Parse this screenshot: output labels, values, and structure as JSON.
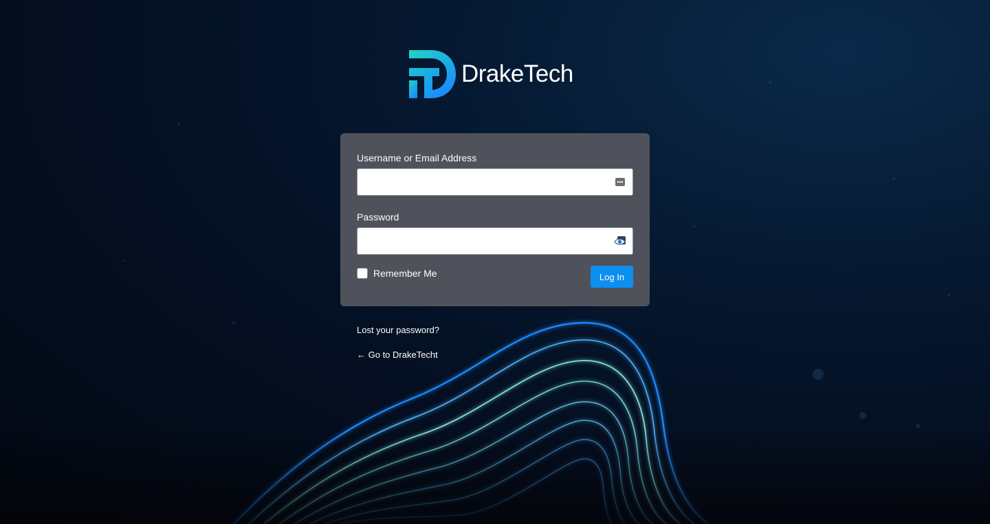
{
  "brand": {
    "name": "DrakeTech",
    "logo_colors": [
      "#1fd4c4",
      "#1a8cff"
    ],
    "icon": "draketech-logo-mark"
  },
  "login_form": {
    "username_label": "Username or Email Address",
    "username_value": "",
    "username_icon": "autofill-key-icon",
    "password_label": "Password",
    "password_value": "",
    "password_icon": "show-password-eye-icon",
    "remember_label": "Remember Me",
    "remember_checked": false,
    "submit_label": "Log In"
  },
  "links": {
    "lost_password": "Lost your password?",
    "back_to_site": "← Go to DrakeTecht"
  },
  "colors": {
    "card_bg": "#4f525b",
    "button_bg": "#0b8ff0",
    "page_bg": "#040f22",
    "wave_blue": "#1a8cff",
    "wave_teal": "#7fe0d8"
  }
}
